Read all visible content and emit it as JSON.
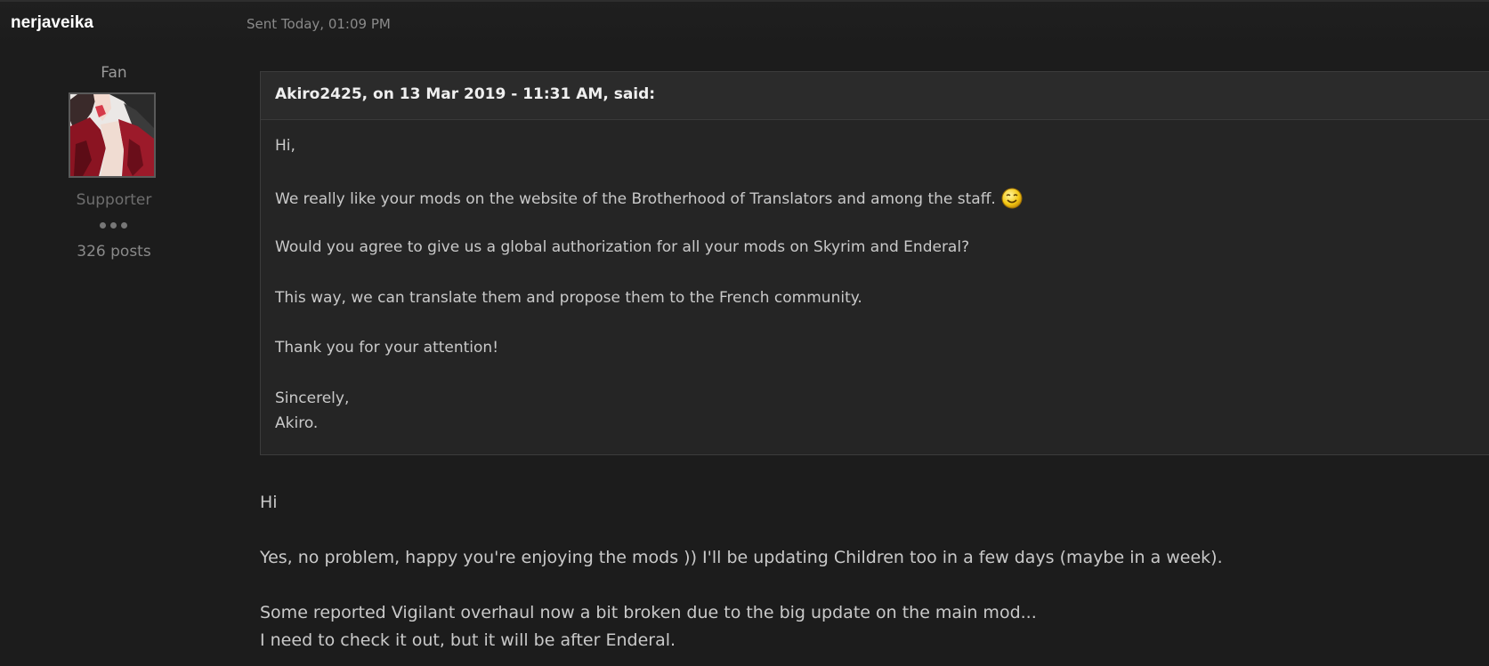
{
  "author": {
    "username": "nerjaveika",
    "rank": "Fan",
    "group": "Supporter",
    "post_count": "326 posts",
    "avatar_icon": "avatar-image"
  },
  "message": {
    "sent": "Sent Today, 01:09 PM"
  },
  "quote": {
    "citation": "Akiro2425, on 13 Mar 2019 - 11:31 AM, said:",
    "lines": [
      "Hi,",
      "We really like your mods on the website of the Brotherhood of Translators and among the staff.",
      "Would you agree to give us a global authorization for all your mods on Skyrim and Enderal?",
      "This way, we can translate them and propose them to the French community.",
      "Thank you for your attention!",
      "Sincerely,",
      "Akiro."
    ],
    "smiley_icon": "smiley-icon"
  },
  "reply": {
    "lines": [
      "Hi",
      "Yes, no problem, happy you're enjoying the mods )) I'll be updating Children too in a few days (maybe in a week).",
      "Some reported Vigilant overhaul now a bit broken due to the big update on the main mod...",
      "I need to check it out, but it will be after Enderal."
    ]
  },
  "colors": {
    "background": "#1c1c1c",
    "quote_background": "#252525",
    "quote_header": "#2b2b2b",
    "text": "#c9c9c9",
    "muted": "#8a8a8a"
  }
}
